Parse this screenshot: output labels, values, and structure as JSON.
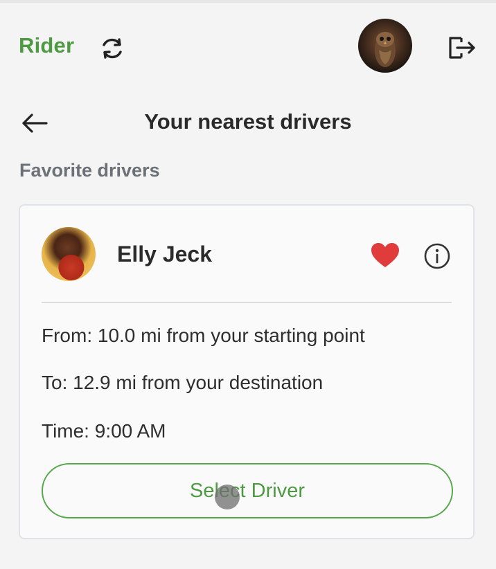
{
  "header": {
    "brand": "Rider",
    "icons": {
      "refresh": "refresh-icon",
      "avatar": "user-avatar",
      "logout": "logout-icon"
    }
  },
  "nav": {
    "title": "Your nearest drivers",
    "back_icon": "arrow-left-icon"
  },
  "section": {
    "title": "Favorite drivers"
  },
  "driver_card": {
    "name": "Elly Jeck",
    "favorite_icon": "heart-icon",
    "favorite_color": "#e03c3c",
    "info_icon": "info-icon",
    "from": "From: 10.0 mi from your starting point",
    "to": "To: 12.9 mi from your destination",
    "time": "Time: 9:00 AM",
    "select_label": "Select Driver"
  },
  "colors": {
    "accent": "#4e9a43",
    "muted": "#6c7178",
    "background": "#f4f4f4"
  }
}
